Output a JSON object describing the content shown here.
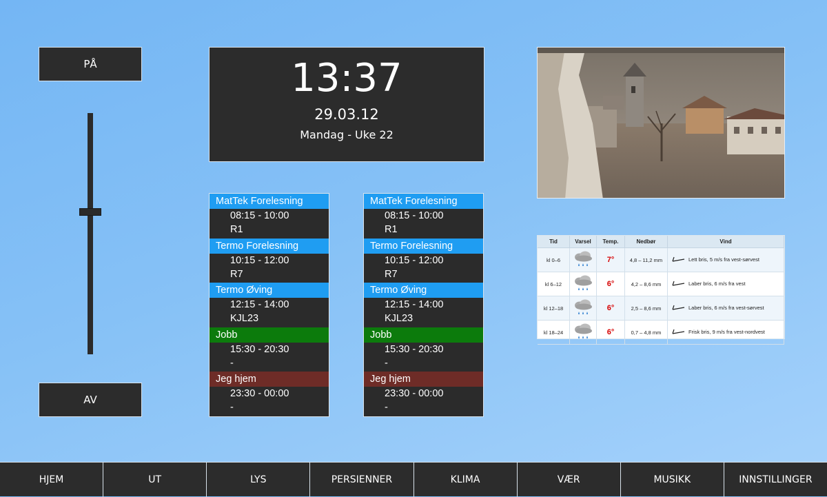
{
  "controls": {
    "on_label": "PÅ",
    "off_label": "AV",
    "dimmer_level": 0.59
  },
  "clock": {
    "time": "13:37",
    "date": "29.03.12",
    "day": "Mandag - Uke 22"
  },
  "schedules": [
    {
      "events": [
        {
          "title": "MatTek Forelesning",
          "color": "blue",
          "time": "08:15 - 10:00",
          "place": "R1"
        },
        {
          "title": "Termo Forelesning",
          "color": "blue",
          "time": "10:15 - 12:00",
          "place": "R7"
        },
        {
          "title": "Termo Øving",
          "color": "blue",
          "time": "12:15 - 14:00",
          "place": "KJL23"
        },
        {
          "title": "Jobb",
          "color": "green",
          "time": "15:30 - 20:30",
          "place": "-"
        },
        {
          "title": "Jeg hjem",
          "color": "red",
          "time": "23:30 - 00:00",
          "place": "-"
        }
      ]
    },
    {
      "events": [
        {
          "title": "MatTek Forelesning",
          "color": "blue",
          "time": "08:15 - 10:00",
          "place": "R1"
        },
        {
          "title": "Termo Forelesning",
          "color": "blue",
          "time": "10:15 - 12:00",
          "place": "R7"
        },
        {
          "title": "Termo Øving",
          "color": "blue",
          "time": "12:15 - 14:00",
          "place": "KJL23"
        },
        {
          "title": "Jobb",
          "color": "green",
          "time": "15:30 - 20:30",
          "place": "-"
        },
        {
          "title": "Jeg hjem",
          "color": "red",
          "time": "23:30 - 00:00",
          "place": "-"
        }
      ]
    }
  ],
  "forecast": {
    "headers": [
      "Tid",
      "Varsel",
      "Temp.",
      "Nedbør",
      "Vind"
    ],
    "rows": [
      {
        "time": "kl 0–6",
        "icon": "rain-cloud-icon",
        "temp": "7°",
        "precip": "4,8 – 11,2 mm",
        "wind": "Lett bris, 5 m/s fra vest-sørvest"
      },
      {
        "time": "kl 6–12",
        "icon": "rain-cloud-icon",
        "temp": "6°",
        "precip": "4,2 – 8,6 mm",
        "wind": "Laber bris, 6 m/s fra vest"
      },
      {
        "time": "kl 12–18",
        "icon": "rain-cloud-icon",
        "temp": "6°",
        "precip": "2,5 – 8,6 mm",
        "wind": "Laber bris, 6 m/s fra vest-sørvest"
      },
      {
        "time": "kl 18–24",
        "icon": "rain-cloud-icon",
        "temp": "6°",
        "precip": "0,7 – 4,8 mm",
        "wind": "Frisk bris, 9 m/s fra vest-nordvest"
      }
    ]
  },
  "nav": {
    "items": [
      "HJEM",
      "UT",
      "LYS",
      "PERSIENNER",
      "KLIMA",
      "VÆR",
      "MUSIKK",
      "INNSTILLINGER"
    ]
  },
  "colors": {
    "panel": "#2c2c2c",
    "event_blue": "#1f9df2",
    "event_green": "#0c7b0c",
    "event_red": "#6e2c27",
    "temp_red": "#d60000"
  }
}
